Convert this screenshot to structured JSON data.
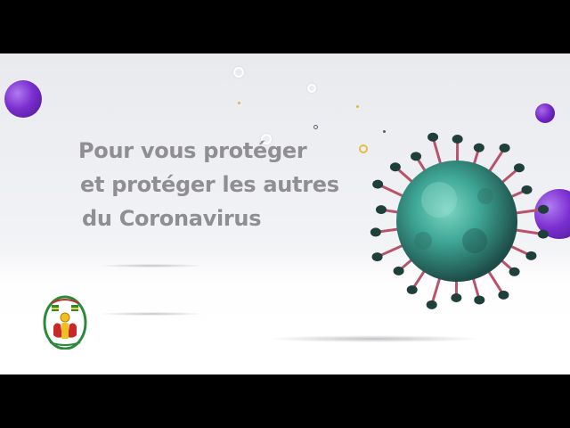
{
  "headline": {
    "line1": "Pour vous protéger",
    "line2": "et protéger les autres",
    "line3": "du Coronavirus"
  },
  "colors": {
    "background": "#eceef1",
    "text": "#8e8e93",
    "purple_accent": "#7b2fd0",
    "virus_teal": "#3fa796",
    "virus_spike_tip": "#1e3f3a",
    "virus_spike_stem": "#b7546d",
    "letterbox": "#000000"
  },
  "icons": {
    "virus": "coronavirus-icon",
    "emblem": "togo-coat-of-arms-icon"
  }
}
